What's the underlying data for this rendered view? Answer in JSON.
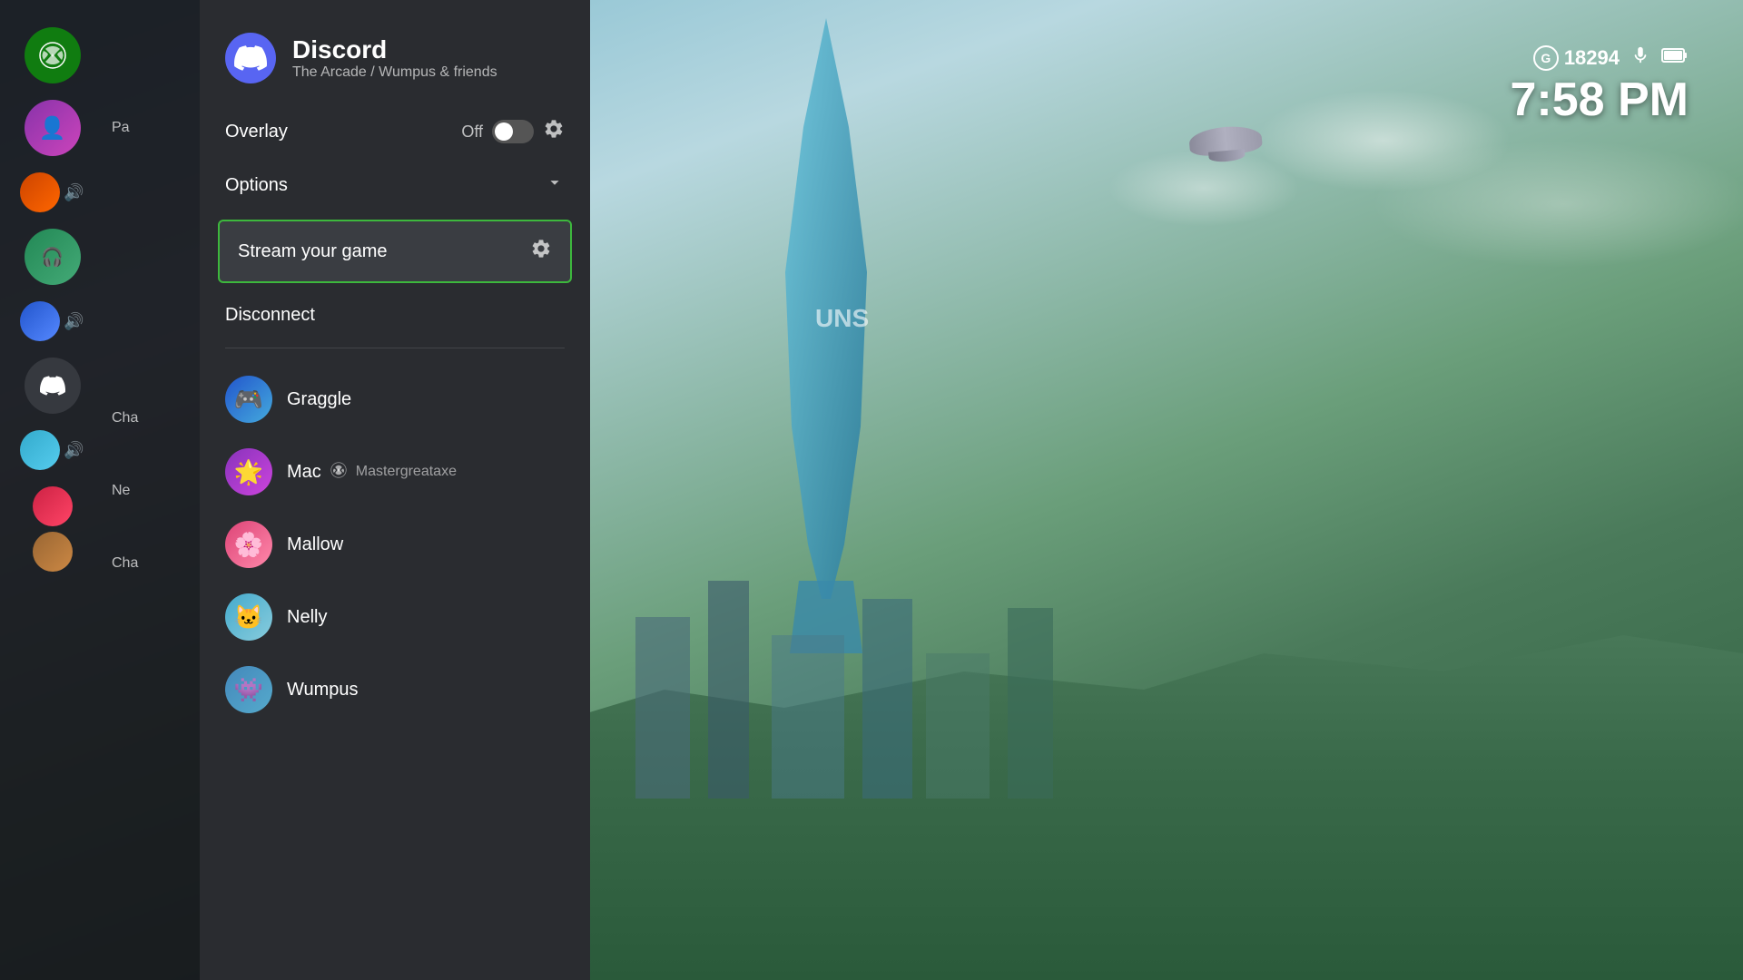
{
  "background": {
    "alt": "Halo game background with sci-fi city and tower"
  },
  "statusBar": {
    "gScore": "18294",
    "gLabel": "G",
    "micIcon": "🎤",
    "batteryIcon": "🔋",
    "time": "7:58 PM"
  },
  "sidebar": {
    "items": [
      {
        "label": "Pa",
        "type": "text"
      },
      {
        "label": "Cha",
        "type": "text"
      },
      {
        "label": "Ne",
        "type": "text"
      },
      {
        "label": "Cha",
        "type": "text"
      }
    ]
  },
  "discord": {
    "title": "Discord",
    "subtitle": "The Arcade / Wumpus & friends",
    "overlay": {
      "label": "Overlay",
      "state": "Off",
      "settingsLabel": "Settings"
    },
    "options": {
      "label": "Options",
      "chevronIcon": "chevron-down"
    },
    "streamButton": {
      "label": "Stream your game",
      "settingsIcon": "gear"
    },
    "disconnect": {
      "label": "Disconnect"
    },
    "friends": [
      {
        "name": "Graggle",
        "avatarClass": "av-graggle",
        "platform": "",
        "gamertag": ""
      },
      {
        "name": "Mac",
        "avatarClass": "av-mac",
        "platform": "xbox",
        "gamertag": "Mastergreataxe"
      },
      {
        "name": "Mallow",
        "avatarClass": "av-mallow",
        "platform": "",
        "gamertag": ""
      },
      {
        "name": "Nelly",
        "avatarClass": "av-nelly",
        "platform": "",
        "gamertag": ""
      },
      {
        "name": "Wumpus",
        "avatarClass": "av-wumpus",
        "platform": "",
        "gamertag": ""
      }
    ]
  }
}
